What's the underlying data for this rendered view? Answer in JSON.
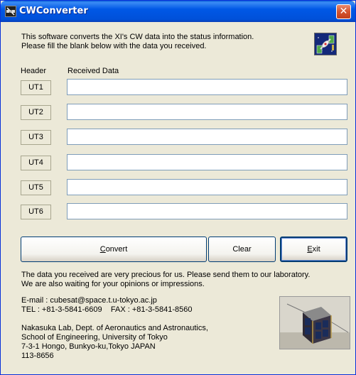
{
  "window": {
    "title": "CWConverter",
    "close_label": "✕"
  },
  "intro": {
    "line1": "This software converts the XI's CW data into the status information.",
    "line2": "Please fill the blank below with the data you received."
  },
  "columns": {
    "header": "Header",
    "received": "Received Data"
  },
  "rows": [
    {
      "header": "UT1",
      "value": ""
    },
    {
      "header": "UT2",
      "value": ""
    },
    {
      "header": "UT3",
      "value": ""
    },
    {
      "header": "UT4",
      "value": ""
    },
    {
      "header": "UT5",
      "value": ""
    },
    {
      "header": "UT6",
      "value": ""
    }
  ],
  "buttons": {
    "convert": {
      "mnemonic": "C",
      "rest": "onvert"
    },
    "clear": "Clear",
    "exit": {
      "mnemonic": "E",
      "rest": "xit"
    }
  },
  "message": {
    "line1": "The data you received are very precious for us. Please send them to our laboratory.",
    "line2": "We are also waiting for your opinions or impressions."
  },
  "contact": {
    "email": "E-mail : cubesat@space.t.u-tokyo.ac.jp",
    "tel_fax": "TEL : +81-3-5841-6609    FAX : +81-3-5841-8560"
  },
  "address": {
    "line1": "Nakasuka Lab, Dept. of Aeronautics and Astronautics,",
    "line2": "School of Engineering, University of Tokyo",
    "line3": "7-3-1 Hongo, Bunkyo-ku,Tokyo JAPAN",
    "line4": "113-8656"
  },
  "colors": {
    "titlebar": "#0058e6",
    "client_bg": "#ece9d8",
    "close": "#d4542f"
  },
  "icons": {
    "app": "satellite-app-icon",
    "logo": "satellite-dish-icon",
    "photo": "cubesat-photo"
  }
}
